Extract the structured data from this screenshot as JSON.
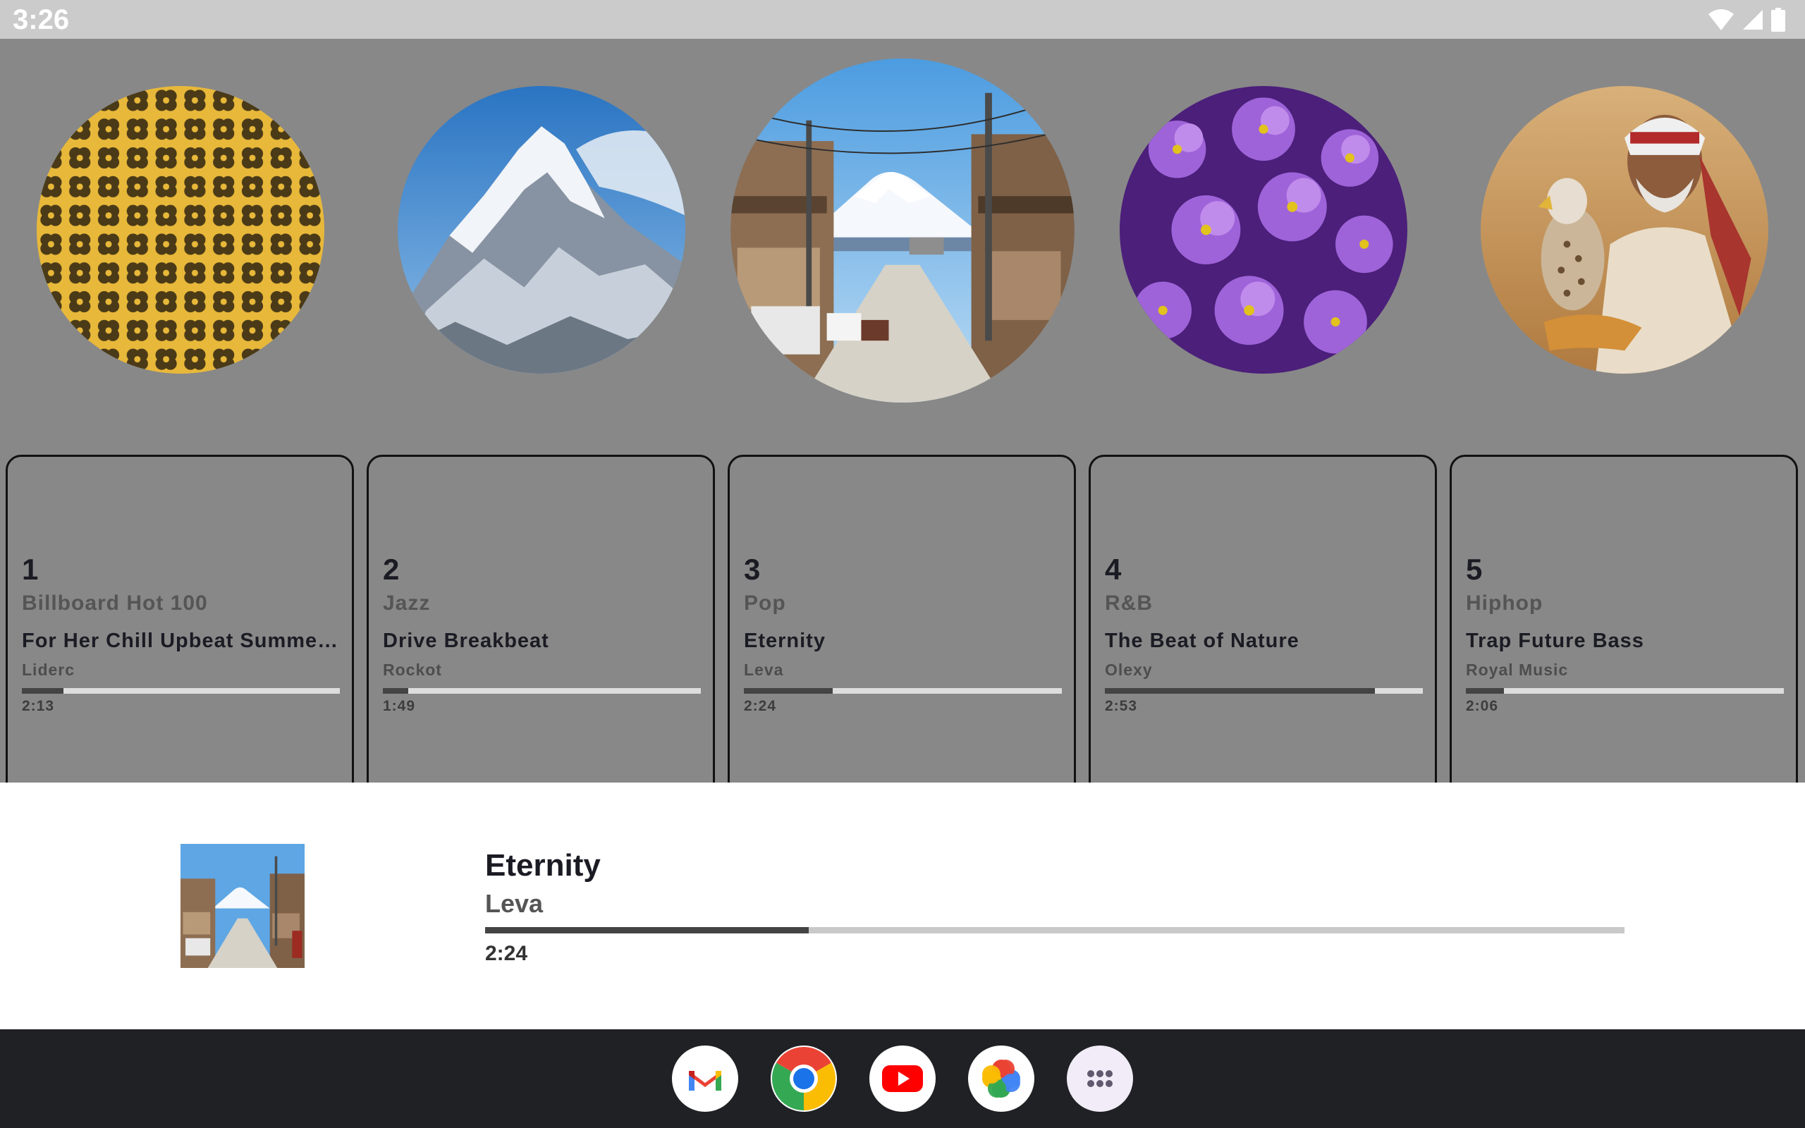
{
  "status_bar": {
    "time": "3:26",
    "icons": [
      "wifi-icon",
      "signal-icon",
      "battery-icon"
    ]
  },
  "carousel": {
    "items": [
      {
        "image": "yellow-clover-pattern"
      },
      {
        "image": "snowy-mountain"
      },
      {
        "image": "street-with-mount-fuji"
      },
      {
        "image": "purple-lilac-flowers"
      },
      {
        "image": "man-with-falcon"
      }
    ],
    "selected_index": 2
  },
  "cards": [
    {
      "index": "1",
      "genre": "Billboard Hot 100",
      "title": "For Her Chill Upbeat Summer Travel Vlog",
      "artist": "Liderc",
      "time": "2:13",
      "progress": 0.13
    },
    {
      "index": "2",
      "genre": "Jazz",
      "title": "Drive Breakbeat",
      "artist": "Rockot",
      "time": "1:49",
      "progress": 0.08
    },
    {
      "index": "3",
      "genre": "Pop",
      "title": "Eternity",
      "artist": "Leva",
      "time": "2:24",
      "progress": 0.28
    },
    {
      "index": "4",
      "genre": "R&B",
      "title": "The Beat of Nature",
      "artist": "Olexy",
      "time": "2:53",
      "progress": 0.85
    },
    {
      "index": "5",
      "genre": "Hiphop",
      "title": "Trap Future Bass",
      "artist": "Royal Music",
      "time": "2:06",
      "progress": 0.12
    }
  ],
  "now_playing": {
    "title": "Eternity",
    "artist": "Leva",
    "time": "2:24",
    "progress": 0.284,
    "art": "street-with-mount-fuji"
  },
  "dock": {
    "apps": [
      {
        "name": "gmail-icon"
      },
      {
        "name": "chrome-icon"
      },
      {
        "name": "youtube-icon"
      },
      {
        "name": "photos-icon"
      },
      {
        "name": "app-drawer-icon"
      }
    ]
  },
  "colors": {
    "background": "#888888",
    "status_bar": "#cbcbcb",
    "dock": "#202125",
    "progress_fill": "#444444",
    "progress_track": "#dddddd"
  }
}
